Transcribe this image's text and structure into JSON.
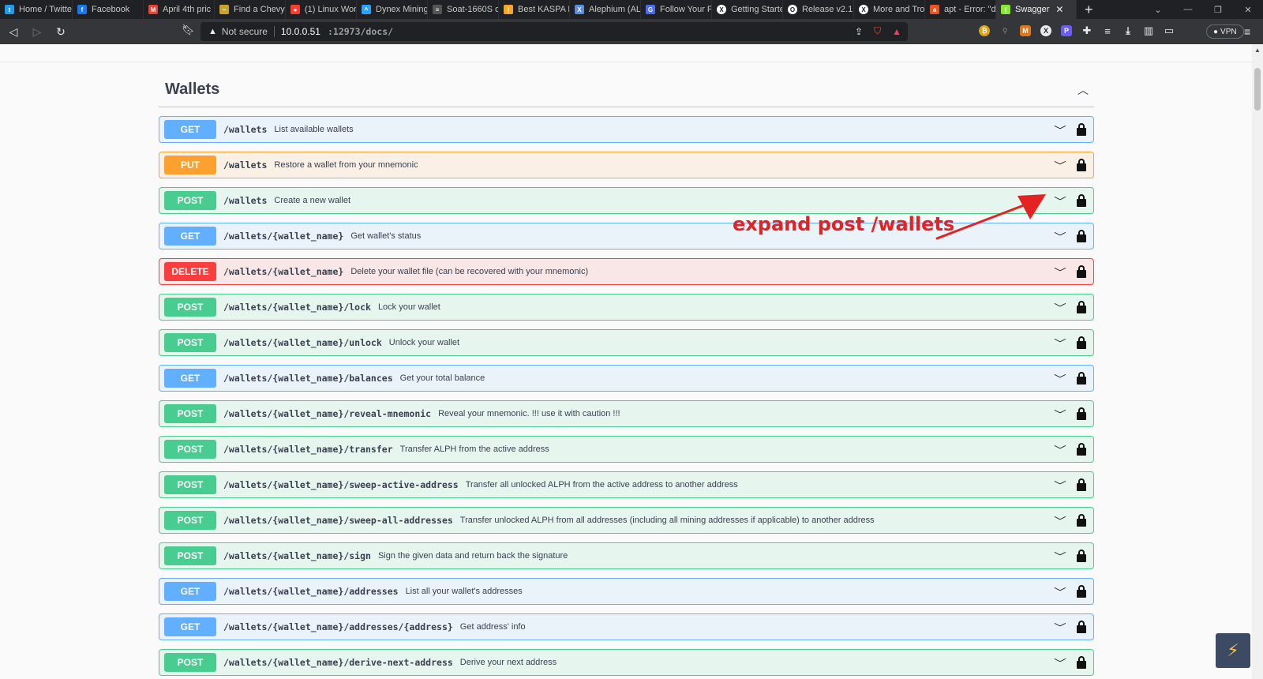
{
  "browser": {
    "tabs": [
      {
        "label": "Home / Twitte",
        "icon": "twitter-icon",
        "color": "#1d9bf0",
        "glyph": "t"
      },
      {
        "label": "Facebook",
        "icon": "facebook-icon",
        "color": "#1877f2",
        "glyph": "f"
      },
      {
        "label": "April 4th pric",
        "icon": "gmail-icon",
        "color": "#ea4335",
        "glyph": "M"
      },
      {
        "label": "Find a Chevy",
        "icon": "chevy-icon",
        "color": "#c9a227",
        "glyph": "~"
      },
      {
        "label": "(1) Linux Worl",
        "icon": "reddit-icon",
        "color": "#ff3b30",
        "glyph": "●"
      },
      {
        "label": "Dynex Mining",
        "icon": "dynex-icon",
        "color": "#2aa3ff",
        "glyph": "^"
      },
      {
        "label": "Soat-1660S d",
        "icon": "page-icon",
        "color": "#555555",
        "glyph": "≡"
      },
      {
        "label": "Best KASPA K",
        "icon": "chart-icon",
        "color": "#f5a623",
        "glyph": "|"
      },
      {
        "label": "Alephium (AL",
        "icon": "alephium-icon",
        "color": "#5b8fd9",
        "glyph": "X"
      },
      {
        "label": "Follow Your F",
        "icon": "globe-icon",
        "color": "#4a6cf7",
        "glyph": "G"
      },
      {
        "label": "Getting Starte",
        "icon": "alephium-icon",
        "color": "#ffffff",
        "glyph": "X"
      },
      {
        "label": "Release v2.1.",
        "icon": "github-icon",
        "color": "#ffffff",
        "glyph": "O"
      },
      {
        "label": "More and Tro",
        "icon": "alephium-icon",
        "color": "#ffffff",
        "glyph": "X"
      },
      {
        "label": "apt - Error: \"d",
        "icon": "askubuntu-icon",
        "color": "#e95420",
        "glyph": "a"
      },
      {
        "label": "Swagger",
        "icon": "swagger-icon",
        "color": "#85ea2d",
        "glyph": "{",
        "active": true
      }
    ],
    "new_tab": "+",
    "url": {
      "security": "Not secure",
      "host": "10.0.0.51",
      "path": ":12973/docs/"
    },
    "vpn": "VPN"
  },
  "section": {
    "title": "Wallets"
  },
  "operations": [
    {
      "method": "GET",
      "path": "/wallets",
      "summary": "List available wallets"
    },
    {
      "method": "PUT",
      "path": "/wallets",
      "summary": "Restore a wallet from your mnemonic"
    },
    {
      "method": "POST",
      "path": "/wallets",
      "summary": "Create a new wallet"
    },
    {
      "method": "GET",
      "path": "/wallets/{wallet_name}",
      "summary": "Get wallet's status"
    },
    {
      "method": "DELETE",
      "path": "/wallets/{wallet_name}",
      "summary": "Delete your wallet file (can be recovered with your mnemonic)"
    },
    {
      "method": "POST",
      "path": "/wallets/{wallet_name}/lock",
      "summary": "Lock your wallet"
    },
    {
      "method": "POST",
      "path": "/wallets/{wallet_name}/unlock",
      "summary": "Unlock your wallet"
    },
    {
      "method": "GET",
      "path": "/wallets/{wallet_name}/balances",
      "summary": "Get your total balance"
    },
    {
      "method": "POST",
      "path": "/wallets/{wallet_name}/reveal-mnemonic",
      "summary": "Reveal your mnemonic. !!! use it with caution !!!"
    },
    {
      "method": "POST",
      "path": "/wallets/{wallet_name}/transfer",
      "summary": "Transfer ALPH from the active address"
    },
    {
      "method": "POST",
      "path": "/wallets/{wallet_name}/sweep-active-address",
      "summary": "Transfer all unlocked ALPH from the active address to another address"
    },
    {
      "method": "POST",
      "path": "/wallets/{wallet_name}/sweep-all-addresses",
      "summary": "Transfer unlocked ALPH from all addresses (including all mining addresses if applicable) to another address"
    },
    {
      "method": "POST",
      "path": "/wallets/{wallet_name}/sign",
      "summary": "Sign the given data and return back the signature"
    },
    {
      "method": "GET",
      "path": "/wallets/{wallet_name}/addresses",
      "summary": "List all your wallet's addresses"
    },
    {
      "method": "GET",
      "path": "/wallets/{wallet_name}/addresses/{address}",
      "summary": "Get address' info"
    },
    {
      "method": "POST",
      "path": "/wallets/{wallet_name}/derive-next-address",
      "summary": "Derive your next address"
    }
  ],
  "annotation": {
    "text": "expand post /wallets",
    "color": "#e52222"
  },
  "colors": {
    "get": "#61affe",
    "put": "#fca130",
    "post": "#49cc90",
    "delete": "#f93e3e"
  }
}
